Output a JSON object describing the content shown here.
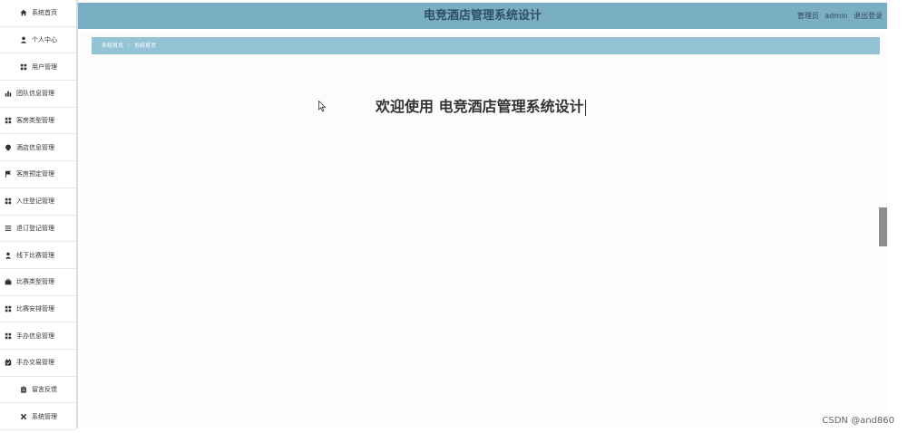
{
  "sidebar": {
    "items": [
      {
        "label": "系统首页",
        "icon": "home-icon"
      },
      {
        "label": "个人中心",
        "icon": "user-icon"
      },
      {
        "label": "用户管理",
        "icon": "grid-icon"
      },
      {
        "label": "团队信息管理",
        "icon": "bar-chart-icon"
      },
      {
        "label": "客房类型管理",
        "icon": "grid-icon"
      },
      {
        "label": "酒店信息管理",
        "icon": "map-pin-icon"
      },
      {
        "label": "客房预定管理",
        "icon": "flag-icon"
      },
      {
        "label": "入住登记管理",
        "icon": "grid-icon"
      },
      {
        "label": "退订登记管理",
        "icon": "list-icon"
      },
      {
        "label": "线下比赛管理",
        "icon": "user-icon"
      },
      {
        "label": "比赛类型管理",
        "icon": "briefcase-icon"
      },
      {
        "label": "比赛安排管理",
        "icon": "grid-icon"
      },
      {
        "label": "手办信息管理",
        "icon": "grid-icon"
      },
      {
        "label": "手办交易管理",
        "icon": "calendar-check-icon"
      },
      {
        "label": "留言反馈",
        "icon": "clipboard-icon"
      },
      {
        "label": "系统管理",
        "icon": "tools-icon"
      }
    ]
  },
  "header": {
    "title": "电竞酒店管理系统设计",
    "role": "管理员",
    "username": "admin",
    "logout": "退出登录"
  },
  "breadcrumb": {
    "home": "系统首页",
    "separator": "⁞",
    "current": "系统首页"
  },
  "main": {
    "welcome": "欢迎使用 电竞酒店管理系统设计"
  },
  "watermark": "CSDN @and860",
  "colors": {
    "header_bg": "#7aaec3",
    "breadcrumb_bg": "#93c3d5",
    "title_text": "#2f4f63"
  }
}
